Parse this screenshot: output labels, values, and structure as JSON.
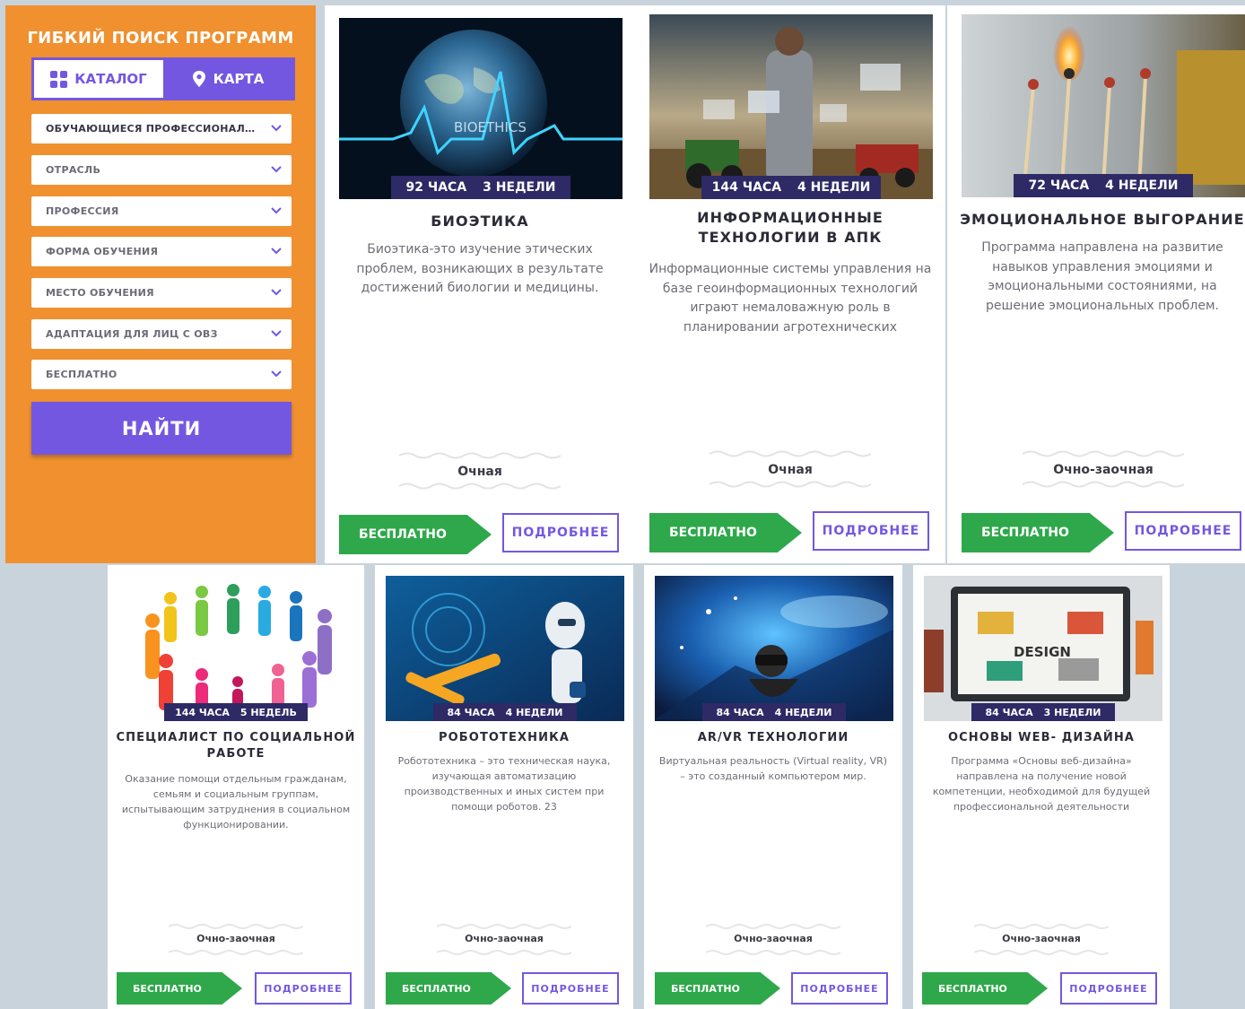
{
  "search": {
    "title": "ГИБКИЙ ПОИСК ПРОГРАММ",
    "tabs": [
      {
        "label": "КАТАЛОГ",
        "icon": "grid-icon",
        "active": false
      },
      {
        "label": "КАРТА",
        "icon": "map-pin-icon",
        "active": true
      }
    ],
    "filters": [
      {
        "value": "ОБУЧАЮЩИЕСЯ ПРОФЕССИОНАЛ…",
        "filled": true
      },
      {
        "value": "ОТРАСЛЬ",
        "filled": false
      },
      {
        "value": "ПРОФЕССИЯ",
        "filled": false
      },
      {
        "value": "ФОРМА ОБУЧЕНИЯ",
        "filled": false
      },
      {
        "value": "МЕСТО ОБУЧЕНИЯ",
        "filled": false
      },
      {
        "value": "АДАПТАЦИЯ ДЛЯ ЛИЦ С ОВЗ",
        "filled": false
      },
      {
        "value": "БЕСПЛАТНО",
        "filled": false
      }
    ],
    "submit_label": "НАЙТИ"
  },
  "colors": {
    "panel_bg": "#f0902f",
    "accent_purple": "#7457e0",
    "free_green": "#2ea84a",
    "duration_bar": "#2d2a66",
    "page_bg": "#c9d3dc"
  },
  "buttons": {
    "free": "БЕСПЛАТНО",
    "more": "ПОДРОБНЕЕ"
  },
  "programs": [
    {
      "hours": "92 ЧАСА",
      "weeks": "3 НЕДЕЛИ",
      "title": "БИОЭТИКА",
      "description": "Биоэтика-это изучение этических проблем, возникающих в результате достижений биологии и медицины.",
      "mode": "Очная",
      "image_text": "BIOETHICS"
    },
    {
      "hours": "144 ЧАСА",
      "weeks": "4 НЕДЕЛИ",
      "title": "ИНФОРМАЦИОННЫЕ ТЕХНОЛОГИИ В АПК",
      "description": "Информационные системы управления на базе геоинформационных технологий играют немаловажную роль в планировании агротехнических",
      "mode": "Очная"
    },
    {
      "hours": "72 ЧАСА",
      "weeks": "4 НЕДЕЛИ",
      "title": "ЭМОЦИОНАЛЬНОЕ ВЫГОРАНИЕ",
      "description": "Программа направлена на развитие навыков управления эмоциями и эмоциональными состояниями, на решение эмоциональных проблем.",
      "mode": "Очно-заочная"
    },
    {
      "hours": "144 ЧАСА",
      "weeks": "5 НЕДЕЛЬ",
      "title": "СПЕЦИАЛИСТ ПО СОЦИАЛЬНОЙ РАБОТЕ",
      "description": "Оказание помощи отдельным гражданам, семьям и социальным группам, испытывающим затруднения в социальном функционировании.",
      "mode": "Очно-заочная"
    },
    {
      "hours": "84 ЧАСА",
      "weeks": "4 НЕДЕЛИ",
      "title": "РОБОТОТЕХНИКА",
      "description": "Робототехника – это техническая наука, изучающая автоматизацию производственных и иных систем при помощи роботов. 23",
      "mode": "Очно-заочная"
    },
    {
      "hours": "84 ЧАСА",
      "weeks": "4 НЕДЕЛИ",
      "title": "AR/VR ТЕХНОЛОГИИ",
      "description": "Виртуальная реальность (Virtual reality, VR) – это созданный компьютером мир.",
      "mode": "Очно-заочная"
    },
    {
      "hours": "84 ЧАСА",
      "weeks": "3 НЕДЕЛИ",
      "title": "ОСНОВЫ WEB- ДИЗАЙНА",
      "description": "Программа «Основы веб-дизайна» направлена на получение новой компетенции, необходимой для будущей профессиональной деятельности",
      "mode": "Очно-заочная",
      "image_text": "DESIGN"
    }
  ]
}
